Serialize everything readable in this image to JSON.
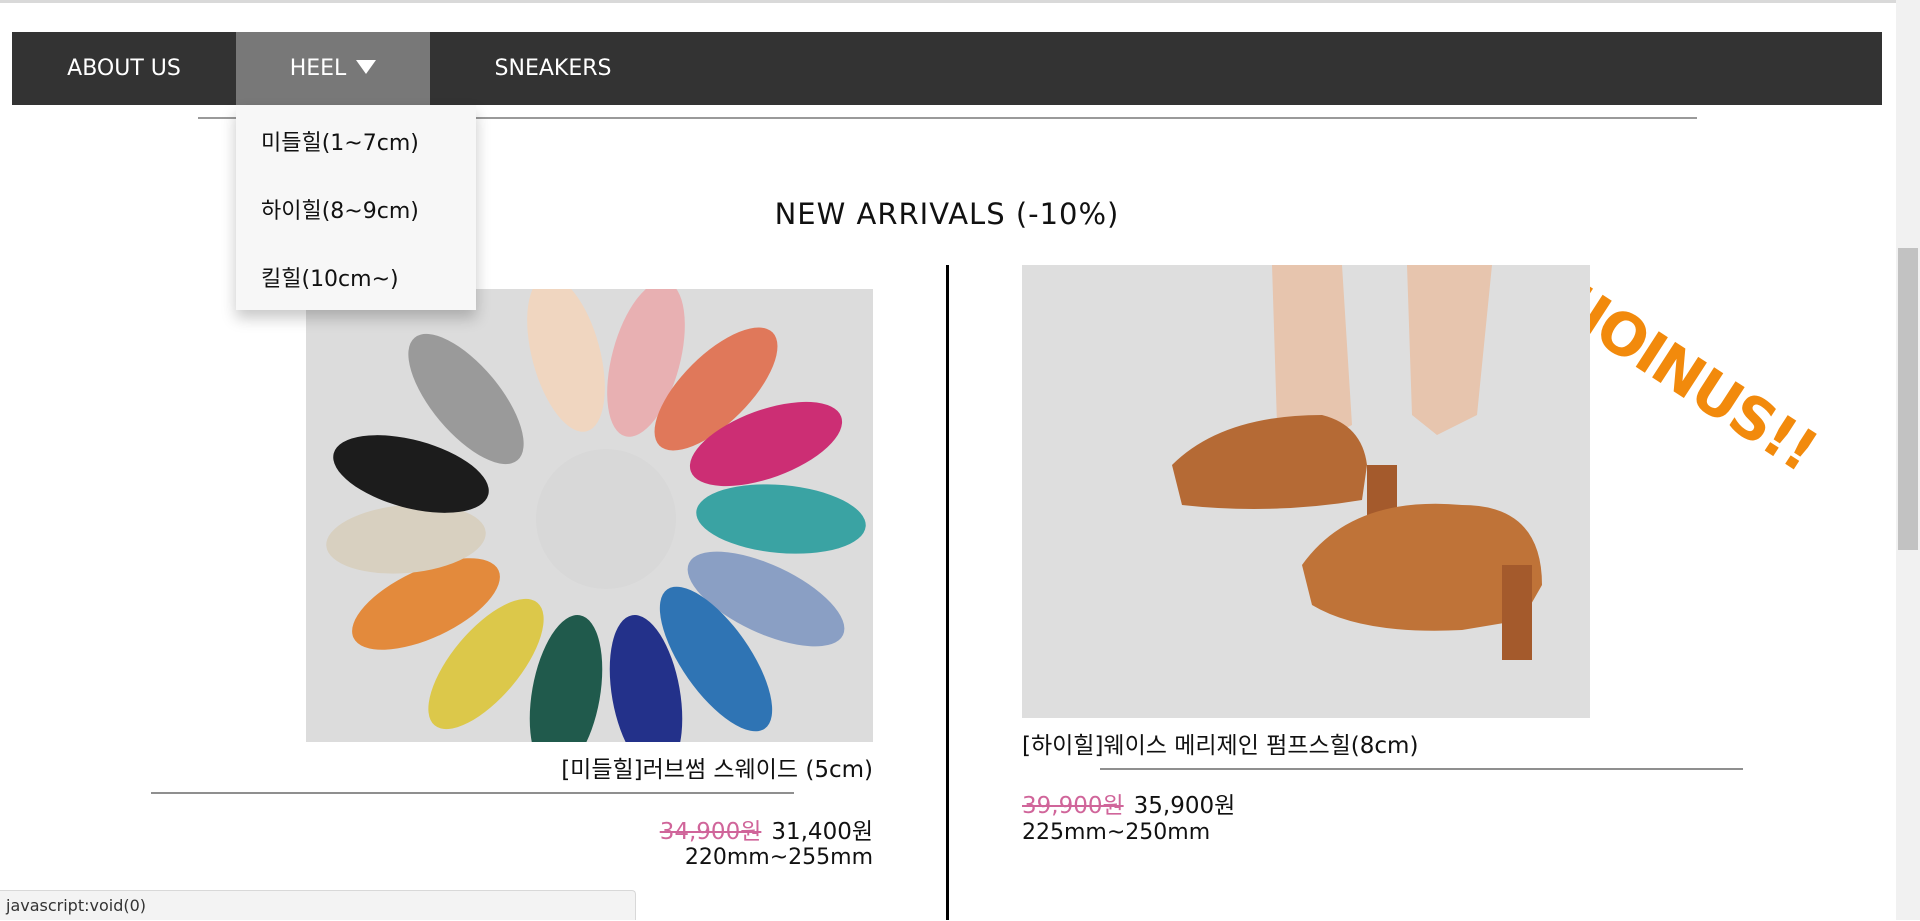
{
  "nav": {
    "items": [
      {
        "label": "ABOUT US"
      },
      {
        "label": "HEEL"
      },
      {
        "label": "SNEAKERS"
      }
    ]
  },
  "dropdown": {
    "items": [
      "미들힐(1~7cm)",
      "하이힐(8~9cm)",
      "킬힐(10cm~)"
    ]
  },
  "section_title": "NEW ARRIVALS (-10%)",
  "joinus_text": "!!JOINUS!!",
  "products": [
    {
      "name": "[미들힐]러브썸 스웨이드 (5cm)",
      "old_price": "34,900원",
      "new_price": "31,400원",
      "size": "220mm~255mm"
    },
    {
      "name": "[하이힐]웨이스 메리제인 펌프스힐(8cm)",
      "old_price": "39,900원",
      "new_price": "35,900원",
      "size": "225mm~250mm"
    }
  ],
  "status_text": "javascript:void(0)",
  "colors": {
    "nav_bg": "#333333",
    "nav_active": "#787878",
    "old_price": "#d0659a",
    "joinus": "#f28a0c"
  }
}
